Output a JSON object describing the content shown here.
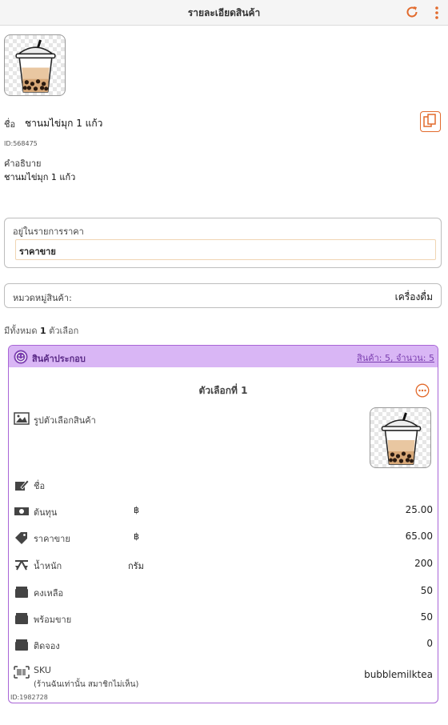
{
  "header": {
    "title": "รายละเอียดสินค้า"
  },
  "product": {
    "name_label": "ชื่อ",
    "name": "ชานมไข่มุก 1 แก้ว",
    "id": "ID:568475",
    "description_label": "คำอธิบาย",
    "description": "ชานมไข่มุก 1 แก้ว"
  },
  "price_list": {
    "label": "อยู่ในรายการราคา",
    "value": "ราคาขาย"
  },
  "category": {
    "label": "หมวดหมู่สินค้า:",
    "value": "เครื่องดื่ม"
  },
  "options_count": {
    "prefix": "มีทั้งหมด",
    "count": "1",
    "suffix": "ตัวเลือก"
  },
  "variant": {
    "header_title": "สินค้าประกอบ",
    "header_link": "สินค้า: 5, จำนวน: 5",
    "title": "ตัวเลือกที่ 1",
    "image_label": "รูปตัวเลือกสินค้า",
    "name_label": "ชื่อ",
    "rows": [
      {
        "label": "ต้นทุน",
        "unit": "฿",
        "value": "25.00"
      },
      {
        "label": "ราคาขาย",
        "unit": "฿",
        "value": "65.00"
      },
      {
        "label": "น้ำหนัก",
        "unit": "กรัม",
        "value": "200"
      },
      {
        "label": "คงเหลือ",
        "unit": "",
        "value": "50"
      },
      {
        "label": "พร้อมขาย",
        "unit": "",
        "value": "50"
      },
      {
        "label": "ติดจอง",
        "unit": "",
        "value": "0"
      }
    ],
    "sku_label": "SKU",
    "sku_note": "(ร้านฉันเท่านั้น สมาชิกไม่เห็น)",
    "sku_value": "bubblemilktea",
    "id": "ID:1982728"
  },
  "colors": {
    "accent": "#e26a2c",
    "variant_border": "#a865d6",
    "variant_header": "#d9b6f5",
    "variant_text": "#5a2a87"
  },
  "icons": {
    "refresh": "refresh-icon",
    "more": "more-vertical-icon",
    "copy": "copy-icon",
    "options": "more-horizontal-icon"
  }
}
